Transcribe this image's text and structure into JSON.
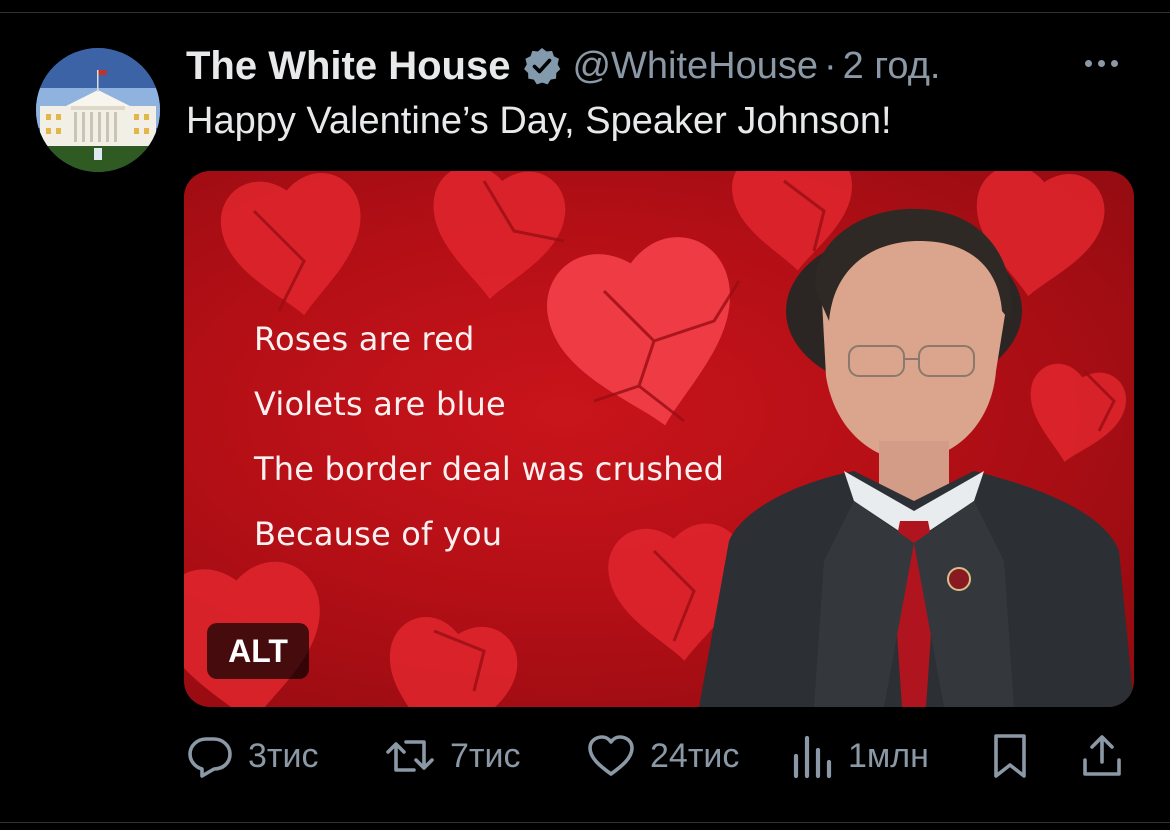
{
  "tweet": {
    "author": {
      "name": "The White House",
      "handle": "@WhiteHouse",
      "verified": true
    },
    "time": "2 год.",
    "separator": "·",
    "text": "Happy Valentine’s Day, Speaker Johnson!",
    "media": {
      "poem": [
        "Roses are red",
        "Violets are blue",
        "The border deal was crushed",
        "Because of you"
      ],
      "alt_label": "ALT"
    },
    "actions": {
      "replies": "3тис",
      "reposts": "7тис",
      "likes": "24тис",
      "views": "1млн"
    }
  },
  "colors": {
    "background": "#000000",
    "text": "#e7e9ea",
    "muted": "#8b98a5",
    "card_red": "#b40f16",
    "verified_badge": "#829aab"
  },
  "icons": [
    "more-icon",
    "verified-icon",
    "reply-icon",
    "repost-icon",
    "like-icon",
    "views-icon",
    "bookmark-icon",
    "share-icon"
  ]
}
